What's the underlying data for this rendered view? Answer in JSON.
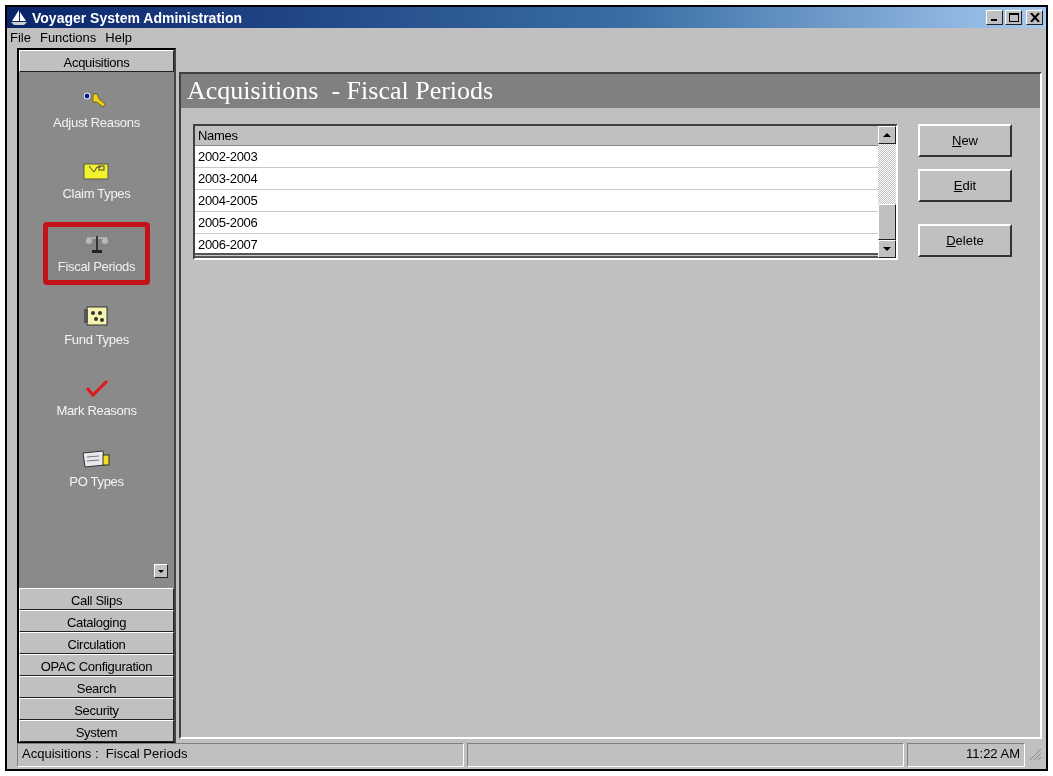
{
  "window": {
    "title": "Voyager System Administration"
  },
  "menu": [
    "File",
    "Functions",
    "Help"
  ],
  "sidebar": {
    "sections": [
      {
        "label": "Acquisitions",
        "expanded": true,
        "items": [
          {
            "label": "Adjust Reasons",
            "selected": false
          },
          {
            "label": "Claim Types",
            "selected": false
          },
          {
            "label": "Fiscal Periods",
            "selected": true
          },
          {
            "label": "Fund Types",
            "selected": false
          },
          {
            "label": "Mark Reasons",
            "selected": false
          },
          {
            "label": "PO Types",
            "selected": false
          }
        ]
      },
      {
        "label": "Call Slips",
        "expanded": false
      },
      {
        "label": "Cataloging",
        "expanded": false
      },
      {
        "label": "Circulation",
        "expanded": false
      },
      {
        "label": "OPAC Configuration",
        "expanded": false
      },
      {
        "label": "Search",
        "expanded": false
      },
      {
        "label": "Security",
        "expanded": false
      },
      {
        "label": "System",
        "expanded": false
      }
    ]
  },
  "content": {
    "title": "Acquisitions  - Fiscal Periods",
    "table": {
      "columns": [
        "Names"
      ],
      "rows": [
        [
          "2002-2003"
        ],
        [
          "2003-2004"
        ],
        [
          "2004-2005"
        ],
        [
          "2005-2006"
        ],
        [
          "2006-2007"
        ]
      ]
    },
    "buttons": [
      "New",
      "Edit",
      "Delete"
    ]
  },
  "status_bar": {
    "text": "Acquisitions :  Fiscal Periods",
    "time": "11:22 AM"
  }
}
